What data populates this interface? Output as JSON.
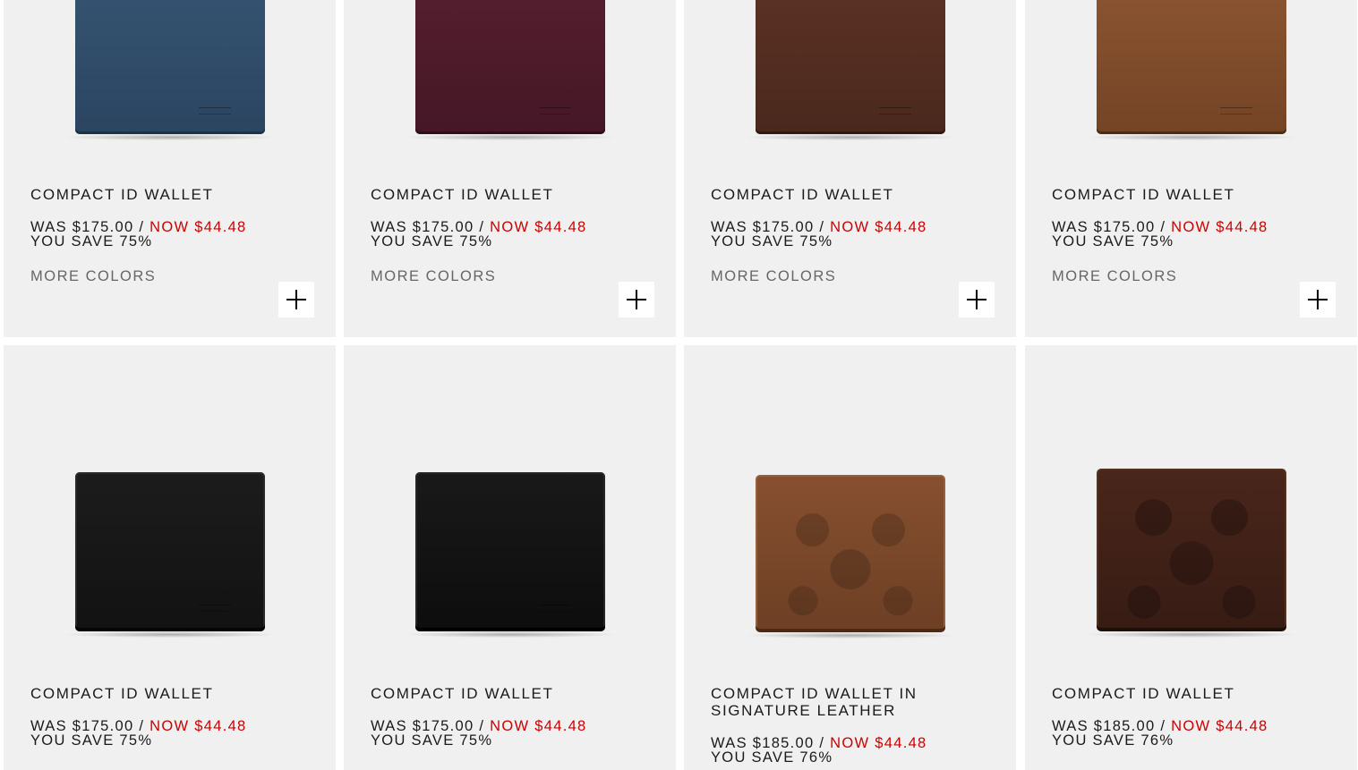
{
  "products": [
    {
      "title": "COMPACT ID WALLET",
      "was": "WAS $175.00 / ",
      "now": "NOW $44.48",
      "save": "YOU SAVE 75%",
      "more": "MORE COLORS",
      "color": "#2f4f6b"
    },
    {
      "title": "COMPACT ID WALLET",
      "was": "WAS $175.00 / ",
      "now": "NOW $44.48",
      "save": "YOU SAVE 75%",
      "more": "MORE COLORS",
      "color": "#4a1a27"
    },
    {
      "title": "COMPACT ID WALLET",
      "was": "WAS $175.00 / ",
      "now": "NOW $44.48",
      "save": "YOU SAVE 75%",
      "more": "MORE COLORS",
      "color": "#4f2a1f"
    },
    {
      "title": "COMPACT ID WALLET",
      "was": "WAS $175.00 / ",
      "now": "NOW $44.48",
      "save": "YOU SAVE 75%",
      "more": "MORE COLORS",
      "color": "#7b4a26"
    },
    {
      "title": "COMPACT ID WALLET",
      "was": "WAS $175.00 / ",
      "now": "NOW $44.48",
      "save": "YOU SAVE 75%",
      "color": "#151515"
    },
    {
      "title": "COMPACT ID WALLET",
      "was": "WAS $175.00 / ",
      "now": "NOW $44.48",
      "save": "YOU SAVE 75%",
      "color": "#0f0f0f"
    },
    {
      "title": "COMPACT ID WALLET IN SIGNATURE LEATHER",
      "was": "WAS $185.00 / ",
      "now": "NOW $44.48",
      "save": "YOU SAVE 76%",
      "color": "#7a4528"
    },
    {
      "title": "COMPACT ID WALLET",
      "was": "WAS $185.00 / ",
      "now": "NOW $44.48",
      "save": "YOU SAVE 76%",
      "color": "#3f2118"
    }
  ],
  "colors": {
    "accent": "#cc0000",
    "card": "#f0f0f0"
  },
  "icons": {
    "add": "plus-icon"
  }
}
